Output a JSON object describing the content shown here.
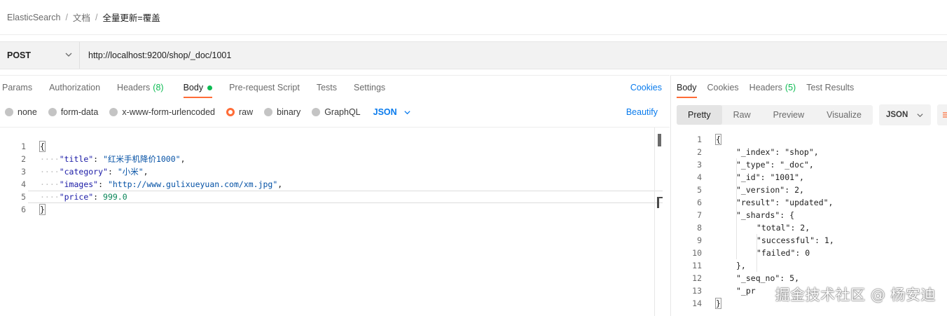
{
  "breadcrumb": {
    "items": [
      "ElasticSearch",
      "文档"
    ],
    "separator": "/",
    "current": "全量更新=覆盖"
  },
  "request": {
    "method": "POST",
    "url": "http://localhost:9200/shop/_doc/1001"
  },
  "request_tabs": [
    {
      "label": "Params"
    },
    {
      "label": "Authorization"
    },
    {
      "label": "Headers",
      "count": "(8)"
    },
    {
      "label": "Body",
      "active": true,
      "indicator": "green-dot"
    },
    {
      "label": "Pre-request Script"
    },
    {
      "label": "Tests"
    },
    {
      "label": "Settings"
    }
  ],
  "cookies_link": "Cookies",
  "body_types": {
    "options": [
      "none",
      "form-data",
      "x-www-form-urlencoded",
      "raw",
      "binary",
      "GraphQL"
    ],
    "selected": "raw",
    "format": "JSON",
    "beautify": "Beautify"
  },
  "request_body": {
    "line_numbers": [
      "1",
      "2",
      "3",
      "4",
      "5",
      "6"
    ],
    "open_brace": "{",
    "close_brace": "}",
    "fields": [
      {
        "key": "\"title\"",
        "value": "\"红米手机降价1000\"",
        "trail": ","
      },
      {
        "key": "\"category\"",
        "value": "\"小米\"",
        "trail": ","
      },
      {
        "key": "\"images\"",
        "value": "\"http://www.gulixueyuan.com/xm.jpg\"",
        "trail": ","
      },
      {
        "key": "\"price\"",
        "value": "999.0",
        "trail": ""
      }
    ]
  },
  "response_tabs": [
    {
      "label": "Body",
      "active": true
    },
    {
      "label": "Cookies"
    },
    {
      "label": "Headers",
      "count": "(5)"
    },
    {
      "label": "Test Results"
    }
  ],
  "response_view": {
    "modes": [
      "Pretty",
      "Raw",
      "Preview",
      "Visualize"
    ],
    "active": "Pretty",
    "format": "JSON"
  },
  "response_body": {
    "line_numbers": [
      "1",
      "2",
      "3",
      "4",
      "5",
      "6",
      "7",
      "8",
      "9",
      "10",
      "11",
      "12",
      "13",
      "14"
    ],
    "lines": [
      "{",
      "\"_index\": \"shop\",",
      "\"_type\": \"_doc\",",
      "\"_id\": \"1001\",",
      "\"_version\": 2,",
      "\"result\": \"updated\",",
      "\"_shards\": {",
      "\"total\": 2,",
      "\"successful\": 1,",
      "\"failed\": 0",
      "},",
      "\"_seq_no\": 5,",
      "\"_pr",
      "}"
    ]
  },
  "watermark": "掘金技术社区 @ 杨安迪",
  "colors": {
    "accent": "#ff6c37",
    "link": "#097bed",
    "success": "#0cbb52"
  }
}
